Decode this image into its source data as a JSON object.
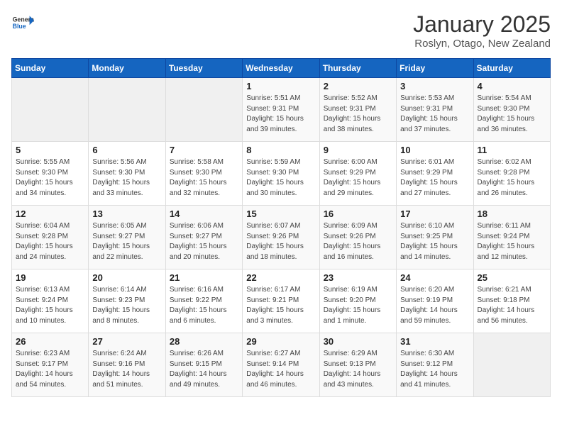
{
  "header": {
    "logo_general": "General",
    "logo_blue": "Blue",
    "month_title": "January 2025",
    "location": "Roslyn, Otago, New Zealand"
  },
  "weekdays": [
    "Sunday",
    "Monday",
    "Tuesday",
    "Wednesday",
    "Thursday",
    "Friday",
    "Saturday"
  ],
  "weeks": [
    [
      {
        "day": "",
        "info": ""
      },
      {
        "day": "",
        "info": ""
      },
      {
        "day": "",
        "info": ""
      },
      {
        "day": "1",
        "info": "Sunrise: 5:51 AM\nSunset: 9:31 PM\nDaylight: 15 hours\nand 39 minutes."
      },
      {
        "day": "2",
        "info": "Sunrise: 5:52 AM\nSunset: 9:31 PM\nDaylight: 15 hours\nand 38 minutes."
      },
      {
        "day": "3",
        "info": "Sunrise: 5:53 AM\nSunset: 9:31 PM\nDaylight: 15 hours\nand 37 minutes."
      },
      {
        "day": "4",
        "info": "Sunrise: 5:54 AM\nSunset: 9:30 PM\nDaylight: 15 hours\nand 36 minutes."
      }
    ],
    [
      {
        "day": "5",
        "info": "Sunrise: 5:55 AM\nSunset: 9:30 PM\nDaylight: 15 hours\nand 34 minutes."
      },
      {
        "day": "6",
        "info": "Sunrise: 5:56 AM\nSunset: 9:30 PM\nDaylight: 15 hours\nand 33 minutes."
      },
      {
        "day": "7",
        "info": "Sunrise: 5:58 AM\nSunset: 9:30 PM\nDaylight: 15 hours\nand 32 minutes."
      },
      {
        "day": "8",
        "info": "Sunrise: 5:59 AM\nSunset: 9:30 PM\nDaylight: 15 hours\nand 30 minutes."
      },
      {
        "day": "9",
        "info": "Sunrise: 6:00 AM\nSunset: 9:29 PM\nDaylight: 15 hours\nand 29 minutes."
      },
      {
        "day": "10",
        "info": "Sunrise: 6:01 AM\nSunset: 9:29 PM\nDaylight: 15 hours\nand 27 minutes."
      },
      {
        "day": "11",
        "info": "Sunrise: 6:02 AM\nSunset: 9:28 PM\nDaylight: 15 hours\nand 26 minutes."
      }
    ],
    [
      {
        "day": "12",
        "info": "Sunrise: 6:04 AM\nSunset: 9:28 PM\nDaylight: 15 hours\nand 24 minutes."
      },
      {
        "day": "13",
        "info": "Sunrise: 6:05 AM\nSunset: 9:27 PM\nDaylight: 15 hours\nand 22 minutes."
      },
      {
        "day": "14",
        "info": "Sunrise: 6:06 AM\nSunset: 9:27 PM\nDaylight: 15 hours\nand 20 minutes."
      },
      {
        "day": "15",
        "info": "Sunrise: 6:07 AM\nSunset: 9:26 PM\nDaylight: 15 hours\nand 18 minutes."
      },
      {
        "day": "16",
        "info": "Sunrise: 6:09 AM\nSunset: 9:26 PM\nDaylight: 15 hours\nand 16 minutes."
      },
      {
        "day": "17",
        "info": "Sunrise: 6:10 AM\nSunset: 9:25 PM\nDaylight: 15 hours\nand 14 minutes."
      },
      {
        "day": "18",
        "info": "Sunrise: 6:11 AM\nSunset: 9:24 PM\nDaylight: 15 hours\nand 12 minutes."
      }
    ],
    [
      {
        "day": "19",
        "info": "Sunrise: 6:13 AM\nSunset: 9:24 PM\nDaylight: 15 hours\nand 10 minutes."
      },
      {
        "day": "20",
        "info": "Sunrise: 6:14 AM\nSunset: 9:23 PM\nDaylight: 15 hours\nand 8 minutes."
      },
      {
        "day": "21",
        "info": "Sunrise: 6:16 AM\nSunset: 9:22 PM\nDaylight: 15 hours\nand 6 minutes."
      },
      {
        "day": "22",
        "info": "Sunrise: 6:17 AM\nSunset: 9:21 PM\nDaylight: 15 hours\nand 3 minutes."
      },
      {
        "day": "23",
        "info": "Sunrise: 6:19 AM\nSunset: 9:20 PM\nDaylight: 15 hours\nand 1 minute."
      },
      {
        "day": "24",
        "info": "Sunrise: 6:20 AM\nSunset: 9:19 PM\nDaylight: 14 hours\nand 59 minutes."
      },
      {
        "day": "25",
        "info": "Sunrise: 6:21 AM\nSunset: 9:18 PM\nDaylight: 14 hours\nand 56 minutes."
      }
    ],
    [
      {
        "day": "26",
        "info": "Sunrise: 6:23 AM\nSunset: 9:17 PM\nDaylight: 14 hours\nand 54 minutes."
      },
      {
        "day": "27",
        "info": "Sunrise: 6:24 AM\nSunset: 9:16 PM\nDaylight: 14 hours\nand 51 minutes."
      },
      {
        "day": "28",
        "info": "Sunrise: 6:26 AM\nSunset: 9:15 PM\nDaylight: 14 hours\nand 49 minutes."
      },
      {
        "day": "29",
        "info": "Sunrise: 6:27 AM\nSunset: 9:14 PM\nDaylight: 14 hours\nand 46 minutes."
      },
      {
        "day": "30",
        "info": "Sunrise: 6:29 AM\nSunset: 9:13 PM\nDaylight: 14 hours\nand 43 minutes."
      },
      {
        "day": "31",
        "info": "Sunrise: 6:30 AM\nSunset: 9:12 PM\nDaylight: 14 hours\nand 41 minutes."
      },
      {
        "day": "",
        "info": ""
      }
    ]
  ]
}
